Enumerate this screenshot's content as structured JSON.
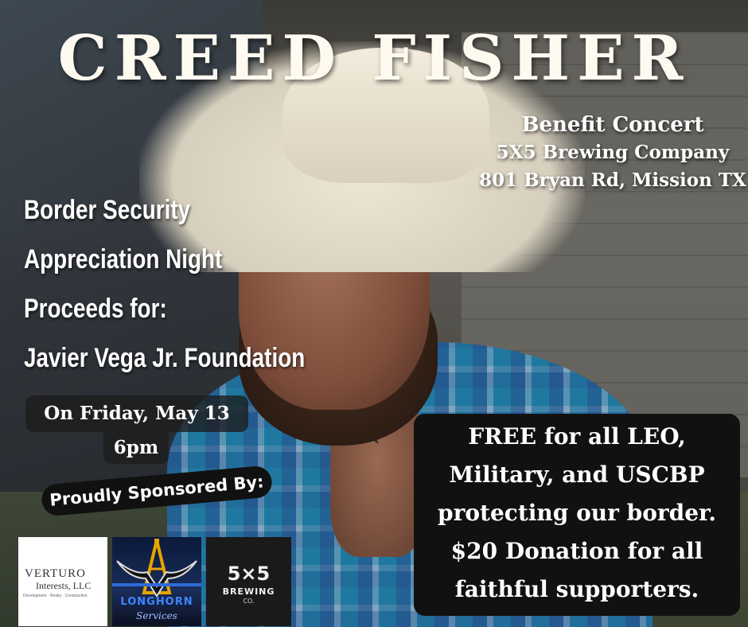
{
  "headline": "CREED FISHER",
  "venue": {
    "line1": "Benefit Concert",
    "line2": "5X5 Brewing Company",
    "line3": "801 Bryan Rd, Mission TX"
  },
  "cause": {
    "line1": "Border Security",
    "line2": "Appreciation Night",
    "line3": "Proceeds for:",
    "line4": "Javier Vega Jr. Foundation"
  },
  "date": {
    "day": "On Friday, May 13",
    "time": "6pm"
  },
  "sponsors": {
    "label": "Proudly Sponsored By:",
    "verturo": {
      "name": "VERTURO",
      "sub": "Interests, LLC",
      "tagline": "Development · Realty · Construction"
    },
    "longhorn": {
      "name": "LONGHORN",
      "sub": "Services"
    },
    "brewing": {
      "mark": "5×5",
      "name": "BREWING",
      "co": "CO."
    }
  },
  "promo": {
    "line1": "FREE for all LEO,",
    "line2": "Military, and USCBP",
    "line3": "protecting our border.",
    "line4": "$20 Donation for all",
    "line5": "faithful supporters."
  },
  "colors": {
    "title": "#fffaf0",
    "panel": "#111111",
    "shirt_plaid": "#2f6d96",
    "hat": "#ede6d5"
  },
  "icons": [
    "star-tattoo",
    "longhorn-logo-icon",
    "drill-derrick-icon"
  ]
}
